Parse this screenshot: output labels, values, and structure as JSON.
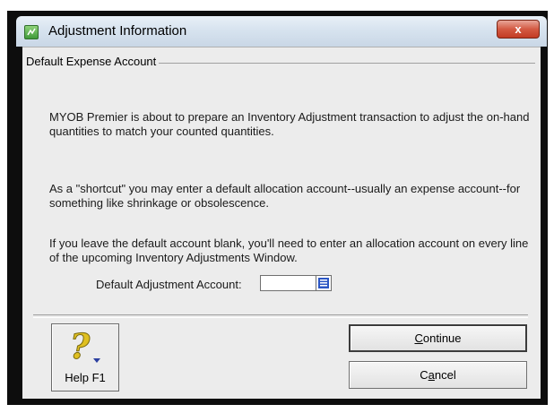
{
  "window": {
    "title": "Adjustment Information",
    "close_glyph": "x"
  },
  "group": {
    "label": "Default Expense Account"
  },
  "paragraphs": [
    "MYOB Premier is about to prepare an Inventory Adjustment transaction to adjust the on-hand quantities to match your counted quantities.",
    "As a \"shortcut\" you may enter a default allocation account--usually an expense account--for something like shrinkage or obsolescence.",
    "If you leave the default account blank, you'll need to enter an allocation account on every line of the upcoming Inventory Adjustments Window."
  ],
  "account_field": {
    "label": "Default Adjustment Account:",
    "value": ""
  },
  "buttons": {
    "help_label": "Help F1",
    "continue_prefix": "",
    "continue_mnemonic": "C",
    "continue_rest": "ontinue",
    "cancel_prefix": "C",
    "cancel_mnemonic": "a",
    "cancel_rest": "ncel"
  },
  "icons": {
    "app": "app-icon",
    "help": "question-mark-icon",
    "list": "list-icon",
    "close": "close-icon"
  },
  "colors": {
    "close_button": "#c9472f",
    "question_mark": "#e0c020",
    "list_icon": "#2b56c4"
  }
}
